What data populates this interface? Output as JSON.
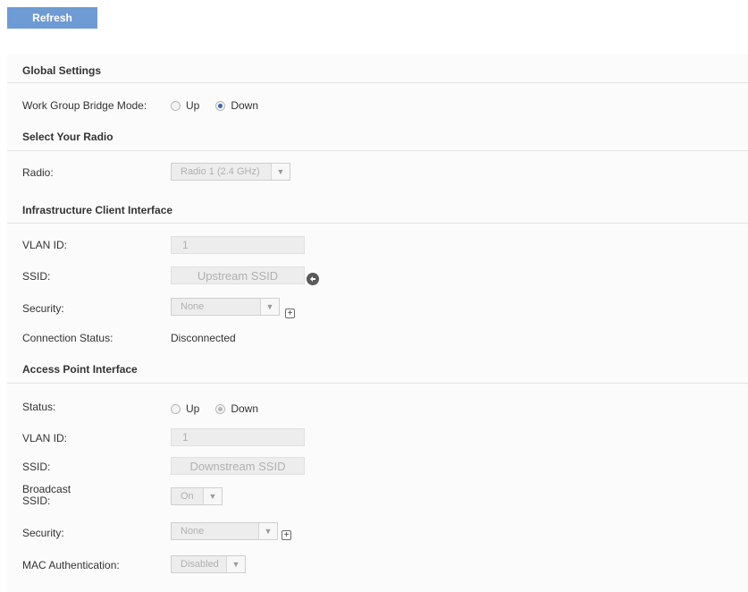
{
  "toolbar": {
    "refresh_label": "Refresh"
  },
  "global": {
    "title": "Global Settings",
    "wgb_label": "Work Group Bridge Mode:",
    "up_label": "Up",
    "down_label": "Down",
    "selected": "Down"
  },
  "radio_section": {
    "title": "Select Your Radio",
    "radio_label": "Radio:",
    "radio_value": "Radio 1 (2.4 GHz)"
  },
  "client": {
    "title": "Infrastructure Client Interface",
    "vlan_label": "VLAN ID:",
    "vlan_value": "1",
    "ssid_label": "SSID:",
    "ssid_value": "Upstream SSID",
    "security_label": "Security:",
    "security_value": "None",
    "conn_label": "Connection Status:",
    "conn_value": "Disconnected"
  },
  "ap": {
    "title": "Access Point Interface",
    "status_label": "Status:",
    "up_label": "Up",
    "down_label": "Down",
    "selected": "Down",
    "vlan_label": "VLAN ID:",
    "vlan_value": "1",
    "ssid_label": "SSID:",
    "ssid_value": "Downstream SSID",
    "broadcast_label_1": "Broadcast",
    "broadcast_label_2": "SSID:",
    "broadcast_value": "On",
    "security_label": "Security:",
    "security_value": "None",
    "mac_label": "MAC Authentication:",
    "mac_value": "Disabled"
  },
  "icons": {
    "caret": "chevron-down-icon",
    "plus": "plus-icon",
    "arrow": "arrow-left-icon"
  }
}
